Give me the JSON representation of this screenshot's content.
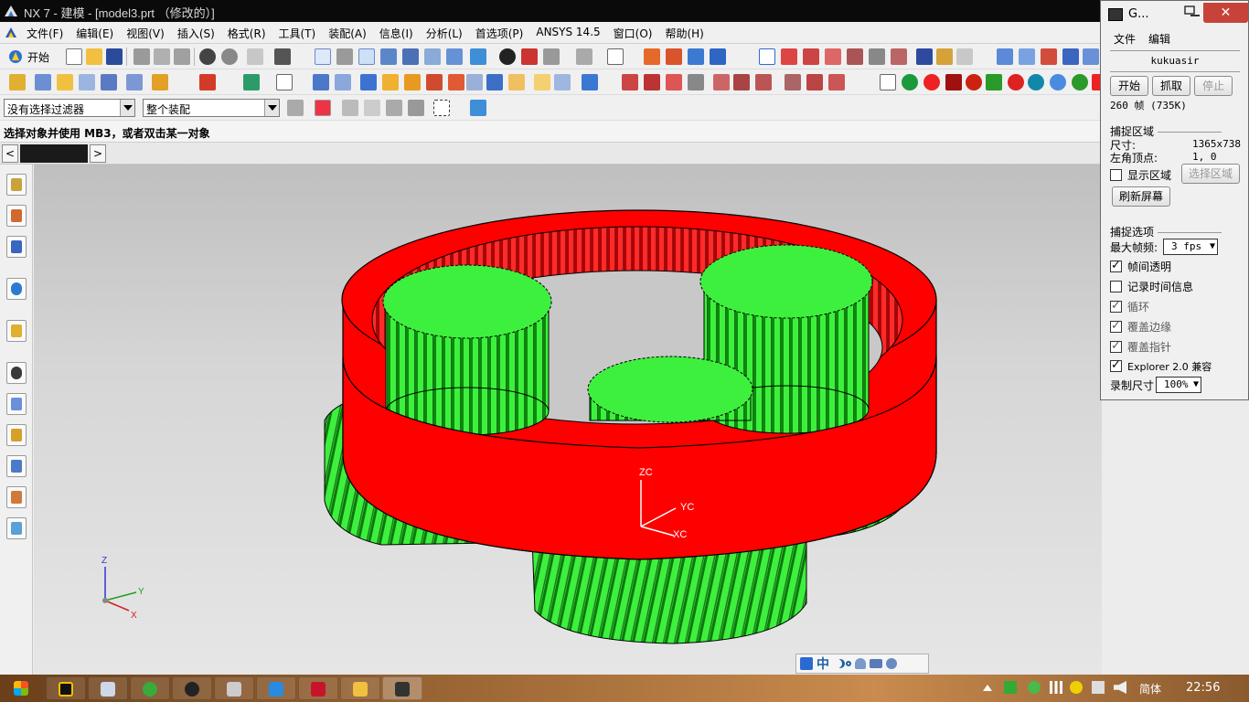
{
  "window": {
    "title": "NX 7 - 建模 - [model3.prt （修改的）]"
  },
  "menu": [
    "文件(F)",
    "编辑(E)",
    "视图(V)",
    "插入(S)",
    "格式(R)",
    "工具(T)",
    "装配(A)",
    "信息(I)",
    "分析(L)",
    "首选项(P)",
    "ANSYS 14.5",
    "窗口(O)",
    "帮助(H)"
  ],
  "toolbar": {
    "start_label": "开始",
    "filter_value": "没有选择过滤器",
    "scope_value": "整个装配"
  },
  "cue_line": "选择对象并使用 MB3，或者双击某一对象",
  "viewport": {
    "wcs_labels": {
      "zc": "ZC",
      "yc": "YC",
      "xc": "XC"
    },
    "abs_labels": {
      "z": "Z",
      "y": "Y",
      "x": "X"
    },
    "colors": {
      "ring_gear": "#ff0000",
      "sun_planet_gears": "#3ef03e",
      "edges": "#000000"
    }
  },
  "capture": {
    "title": "G...",
    "close_label": "✕",
    "menu": [
      "文件",
      "编辑"
    ],
    "user": "kukuasir",
    "buttons": {
      "start": "开始",
      "grab": "抓取",
      "stop": "停止"
    },
    "frames": "260 帧 (735K)",
    "region_header": "捕捉区域",
    "size_label": "尺寸:",
    "size_value": "1365x738",
    "topleft_label": "左角顶点:",
    "topleft_value": "1, 0",
    "show_region_label": "显示区域",
    "select_region_label": "选择区域",
    "refresh_label": "刷新屏幕",
    "options_header": "捕捉选项",
    "max_fps_label": "最大帧频:",
    "max_fps_value": "3 fps",
    "options": [
      {
        "label": "帧间透明",
        "checked": true
      },
      {
        "label": "记录时间信息",
        "checked": false
      },
      {
        "label": "循环",
        "checked": true
      },
      {
        "label": "覆盖边缘",
        "checked": true
      },
      {
        "label": "覆盖指针",
        "checked": true
      },
      {
        "label": "Explorer 2.0 兼容",
        "checked": true
      }
    ],
    "record_size_label": "录制尺寸",
    "record_size_value": "100%"
  },
  "ime": {
    "mode": "中"
  },
  "taskbar": {
    "language": "简体",
    "time": "22:56"
  }
}
